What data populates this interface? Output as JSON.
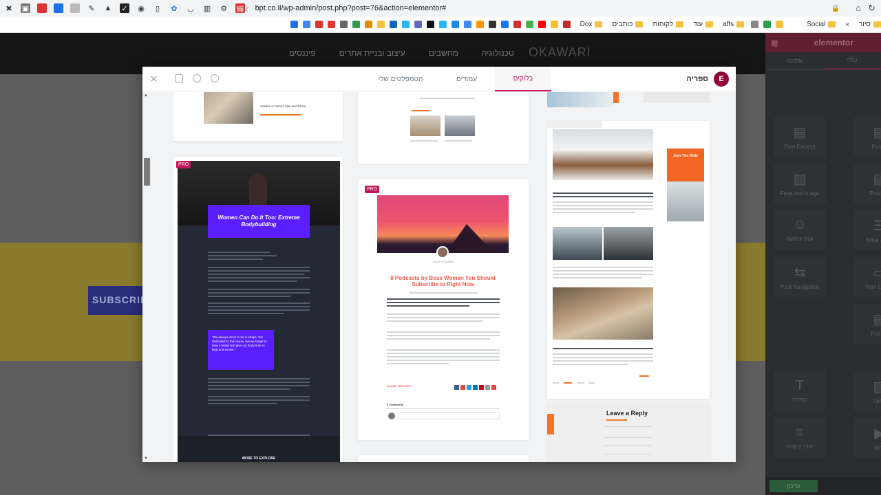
{
  "browser": {
    "url": "bpt.co.il/wp-admin/post.php?post=76&action=elementor#",
    "bookmarks": [
      "סיור",
      "Social",
      "affs",
      "עוד",
      "לקוחות",
      "כותבים",
      "Dox"
    ],
    "bookmarks_overflow": "»"
  },
  "site": {
    "logo": "OKAWARI",
    "nav": [
      "טכנולוגיה",
      "מחשבים",
      "עיצוב ובניית אתרים",
      "פיננסים"
    ],
    "subscribe": "SUBSCRIB"
  },
  "elementor_panel": {
    "brand": "elementor",
    "tabs": [
      "אלמנט",
      "כללי"
    ],
    "widgets": [
      {
        "label": "Post Excerpt",
        "icon": "excerpt-icon"
      },
      {
        "label": "Post T",
        "icon": "title-icon"
      },
      {
        "label": "Featured Image",
        "icon": "image-icon"
      },
      {
        "label": "Post Co",
        "icon": "content-icon"
      },
      {
        "label": "Author Box",
        "icon": "author-icon"
      },
      {
        "label": "Table of Co",
        "icon": "toc-icon"
      },
      {
        "label": "Post Navigation",
        "icon": "navigation-icon"
      },
      {
        "label": "Post Comm",
        "icon": "comments-icon"
      },
      {
        "label": "Post In",
        "icon": "info-icon"
      },
      {
        "label": "כותרת",
        "icon": "heading-icon"
      },
      {
        "label": "תמונה",
        "icon": "image-icon"
      },
      {
        "label": "עורך טקסט",
        "icon": "text-editor-icon"
      },
      {
        "label": "וידאו",
        "icon": "video-icon"
      }
    ],
    "update_button": "עדכון"
  },
  "library": {
    "title": "ספריה",
    "tabs": [
      {
        "label": "בלוקים",
        "active": true
      },
      {
        "label": "עמודים",
        "active": false
      },
      {
        "label": "הטמפלטים שלי",
        "active": false
      }
    ],
    "pro_badge": "PRO",
    "cards": {
      "top_left_caption": "Articles or Items? Tips and Tricks",
      "fitness_title": "Women Can Do It Too: Extreme Bodybuilding",
      "fitness_quote": "\"We always strive to be in shape. We dedicated to this cause, but we forget to take a break and give our body time to heal and evolve.\"",
      "fitness_footer": "MORE TO EXPLORE",
      "podcast_title": "8 Podcasts by Boss Women You Should Subscribe to Right Now",
      "podcast_author": "NOVA VIVIANNE",
      "podcast_share": "SHARE THIS POST",
      "podcast_comments": "0 Comments",
      "join_title": "Join The Ride",
      "leave_reply": "Leave a Reply"
    }
  },
  "colors": {
    "accent": "#c2185b",
    "purple": "#5b1fff",
    "orange": "#f27424"
  }
}
